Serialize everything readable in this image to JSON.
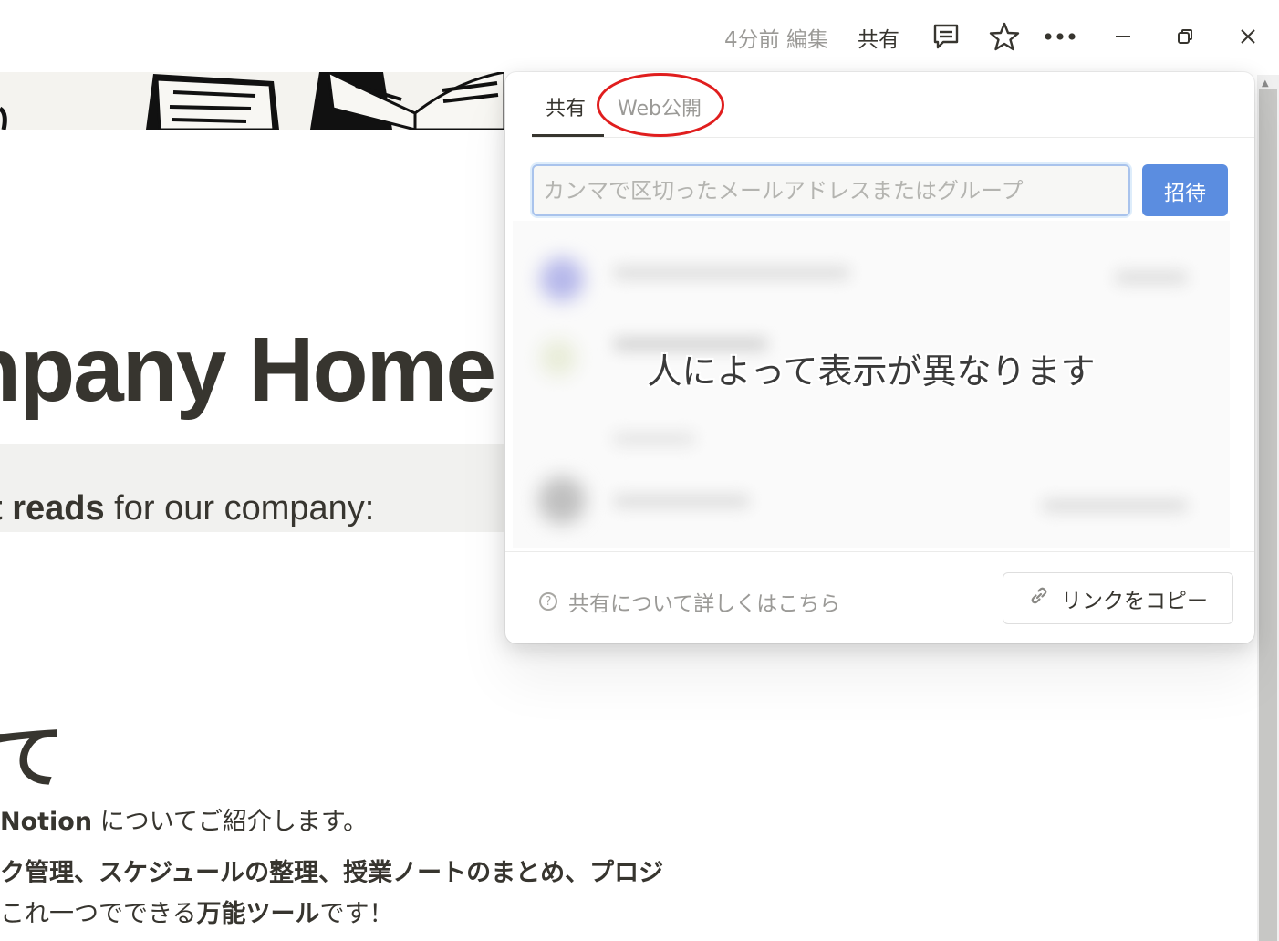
{
  "topbar": {
    "edited": "4分前 編集",
    "share": "共有",
    "icons": [
      "comment-icon",
      "star-icon",
      "more-icon",
      "minimize-icon",
      "restore-icon",
      "close-icon"
    ]
  },
  "page": {
    "title": "npany Home",
    "callout_bold": "t reads",
    "callout_rest": " for our company:",
    "heading": "て",
    "para1_bold": "Notion",
    "para1_rest": " についてご紹介します。",
    "para2": "ク管理、スケジュールの整理、授業ノートのまとめ、プロジ",
    "para3_pre": "これ一つでできる",
    "para3_bold": "万能ツール",
    "para3_post": "です！"
  },
  "share_popup": {
    "tabs": [
      "共有",
      "Web公開"
    ],
    "active_tab": "共有",
    "email_placeholder": "カンマで区切ったメールアドレスまたはグループ",
    "invite_label": "招待",
    "members_note": "人によって表示が異なります",
    "learn_more": "共有について詳しくはこちら",
    "copy_link": "リンクをコピー",
    "colors": {
      "invite": "#5b8de0",
      "highlight": "#e01e1e"
    }
  }
}
